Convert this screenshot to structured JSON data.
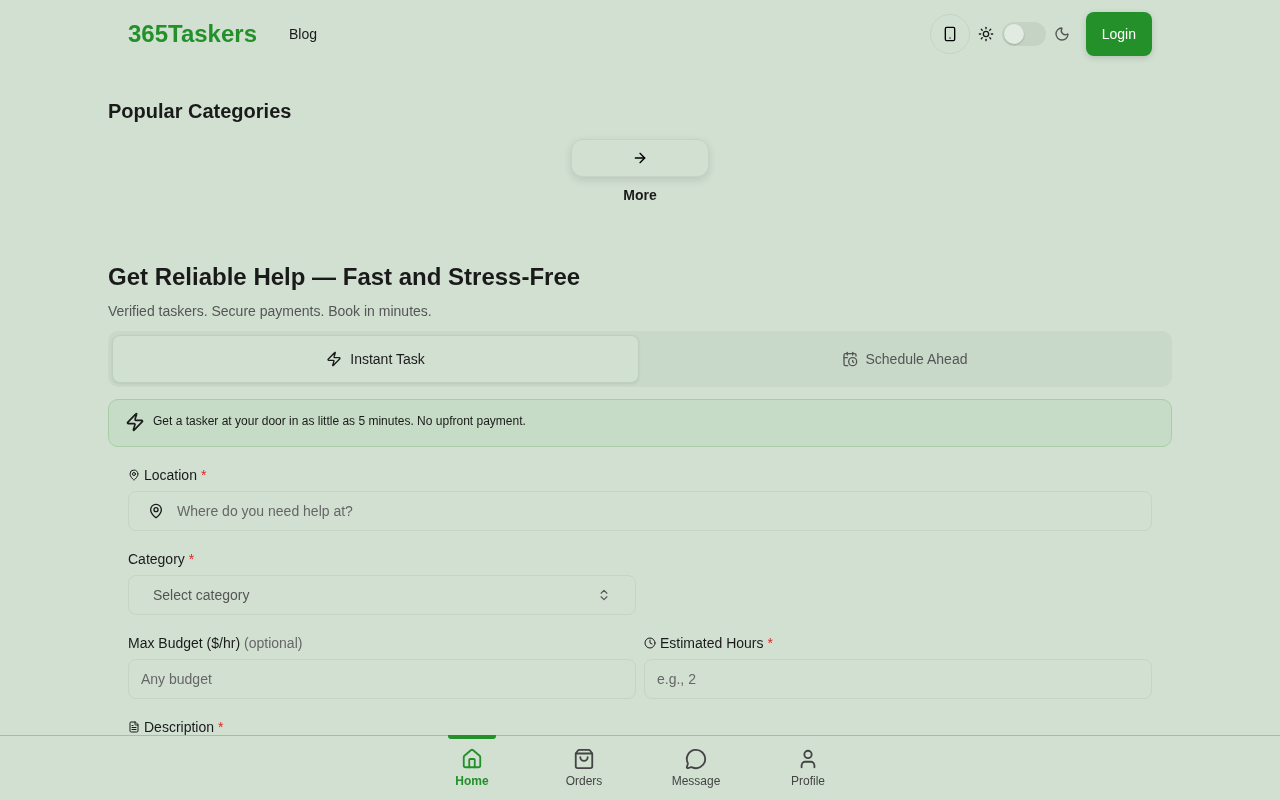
{
  "header": {
    "logo": "365Taskers",
    "nav": [
      "Blog"
    ],
    "dark_mode": false,
    "login": "Login"
  },
  "categories": {
    "title": "Popular Categories",
    "more": "More"
  },
  "hero": {
    "title": "Get Reliable Help — Fast and Stress-Free",
    "subtitle": "Verified taskers. Secure payments. Book in minutes."
  },
  "tabs": [
    {
      "label": "Instant Task",
      "kind": "instant",
      "selected": true
    },
    {
      "label": "Schedule Ahead",
      "kind": "schedule",
      "selected": false
    }
  ],
  "notice": "Get a tasker at your door in as little as 5 minutes. No upfront payment.",
  "form": {
    "location": {
      "label": "Location",
      "required": "*",
      "placeholder": "Where do you need help at?"
    },
    "category": {
      "label": "Category",
      "required": "*",
      "placeholder": "Select category"
    },
    "budget": {
      "label": "Max Budget ($/hr)",
      "hint": "(optional)",
      "placeholder": "Any budget"
    },
    "hours": {
      "label": "Estimated Hours",
      "required": "*",
      "placeholder": "e.g., 2"
    },
    "description": {
      "label": "Description",
      "required": "*"
    }
  },
  "bottom_nav": [
    {
      "label": "Home",
      "kind": "home",
      "selected": true
    },
    {
      "label": "Orders",
      "kind": "orders",
      "selected": false
    },
    {
      "label": "Message",
      "kind": "message",
      "selected": false
    },
    {
      "label": "Profile",
      "kind": "profile",
      "selected": false
    }
  ]
}
